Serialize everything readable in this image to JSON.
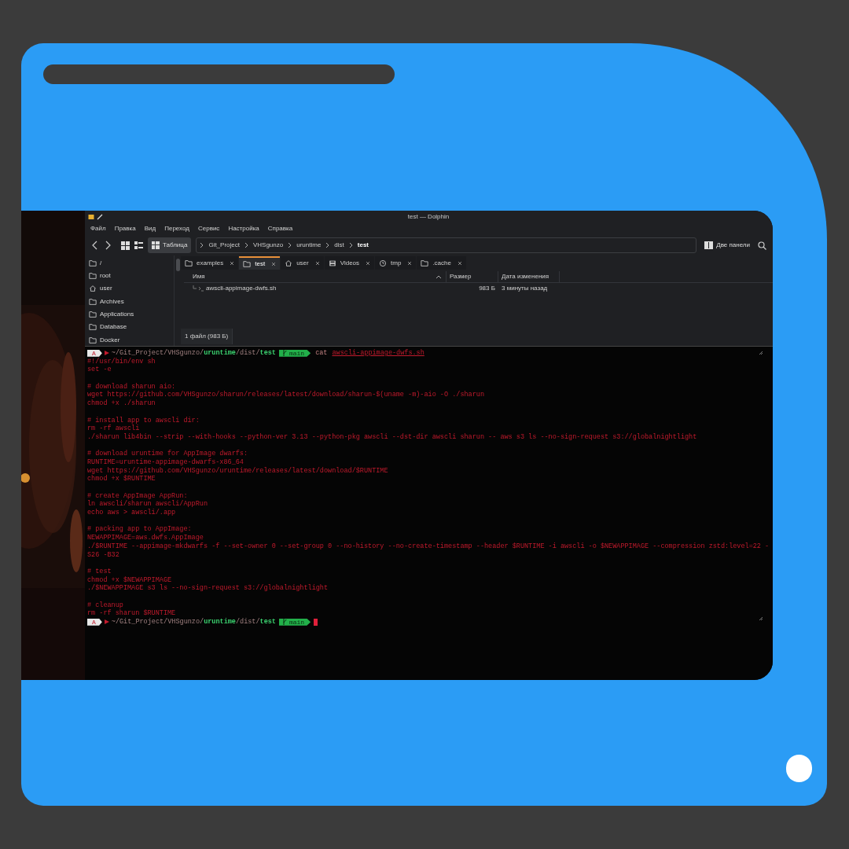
{
  "dolphin": {
    "title": "test — Dolphin",
    "menu": [
      "Файл",
      "Правка",
      "Вид",
      "Переход",
      "Сервис",
      "Настройка",
      "Справка"
    ],
    "view_button": "Таблица",
    "breadcrumb": [
      {
        "label": "Git_Project",
        "selected": false
      },
      {
        "label": "VHSgunzo",
        "selected": false
      },
      {
        "label": "uruntime",
        "selected": false
      },
      {
        "label": "dist",
        "selected": false
      },
      {
        "label": "test",
        "selected": true
      }
    ],
    "split_button": "Две панели",
    "places": [
      {
        "label": "/",
        "kind": "folder"
      },
      {
        "label": "root",
        "kind": "folder"
      },
      {
        "label": "user",
        "kind": "home"
      },
      {
        "label": "Archives",
        "kind": "folder"
      },
      {
        "label": "Applications",
        "kind": "folder"
      },
      {
        "label": "Database",
        "kind": "folder"
      },
      {
        "label": "Docker",
        "kind": "folder"
      }
    ],
    "tabs": [
      {
        "label": "examples",
        "kind": "folder",
        "selected": false
      },
      {
        "label": "test",
        "kind": "folder",
        "selected": true
      },
      {
        "label": "user",
        "kind": "home",
        "selected": false
      },
      {
        "label": "Videos",
        "kind": "film",
        "selected": false
      },
      {
        "label": "tmp",
        "kind": "clock",
        "selected": false
      },
      {
        "label": ".cache",
        "kind": "folder",
        "selected": false
      }
    ],
    "columns": [
      "Имя",
      "Размер",
      "Дата изменения"
    ],
    "rows": [
      {
        "name": "awscli-appimage-dwfs.sh",
        "size": "983 Б",
        "modified": "3 минуты назад"
      }
    ],
    "status": "1 файл (983 Б)"
  },
  "terminal": {
    "lines": [
      {
        "kind": "prompt",
        "badge": "A",
        "path": [
          {
            "text": "~/Git_Project/VHSgunzo/",
            "highlight": false
          },
          {
            "text": "uruntime",
            "highlight": true
          },
          {
            "text": "/dist/",
            "highlight": false
          },
          {
            "text": "test",
            "highlight": true
          }
        ],
        "branch": "main",
        "command": "cat",
        "argument": "awscli-appimage-dwfs.sh",
        "cursor": false
      },
      {
        "kind": "text",
        "text": "#!/usr/bin/env sh"
      },
      {
        "kind": "text",
        "text": "set -e"
      },
      {
        "kind": "blank"
      },
      {
        "kind": "text",
        "text": "# download sharun aio:"
      },
      {
        "kind": "text",
        "text": "wget https://github.com/VHSgunzo/sharun/releases/latest/download/sharun-$(uname -m)-aio -O ./sharun"
      },
      {
        "kind": "text",
        "text": "chmod +x ./sharun"
      },
      {
        "kind": "blank"
      },
      {
        "kind": "text",
        "text": "# install app to awscli dir:"
      },
      {
        "kind": "text",
        "text": "rm -rf awscli"
      },
      {
        "kind": "text",
        "text": "./sharun lib4bin --strip --with-hooks --python-ver 3.13 --python-pkg awscli --dst-dir awscli sharun -- aws s3 ls --no-sign-request s3://globalnightlight"
      },
      {
        "kind": "blank"
      },
      {
        "kind": "text",
        "text": "# download uruntime for AppImage dwarfs:"
      },
      {
        "kind": "text",
        "text": "RUNTIME=uruntime-appimage-dwarfs-x86_64"
      },
      {
        "kind": "text",
        "text": "wget https://github.com/VHSgunzo/uruntime/releases/latest/download/$RUNTIME"
      },
      {
        "kind": "text",
        "text": "chmod +x $RUNTIME"
      },
      {
        "kind": "blank"
      },
      {
        "kind": "text",
        "text": "# create AppImage AppRun:"
      },
      {
        "kind": "text",
        "text": "ln awscli/sharun awscli/AppRun"
      },
      {
        "kind": "text",
        "text": "echo aws > awscli/.app"
      },
      {
        "kind": "blank"
      },
      {
        "kind": "text",
        "text": "# packing app to AppImage:"
      },
      {
        "kind": "text",
        "text": "NEWAPPIMAGE=aws.dwfs.AppImage"
      },
      {
        "kind": "text",
        "text": "./$RUNTIME --appimage-mkdwarfs -f --set-owner 0 --set-group 0 --no-history --no-create-timestamp --header $RUNTIME -i awscli -o $NEWAPPIMAGE --compression zstd:level=22 -"
      },
      {
        "kind": "text",
        "text": "S26 -B32"
      },
      {
        "kind": "blank"
      },
      {
        "kind": "text",
        "text": "# test"
      },
      {
        "kind": "text",
        "text": "chmod +x $NEWAPPIMAGE"
      },
      {
        "kind": "text",
        "text": "./$NEWAPPIMAGE s3 ls --no-sign-request s3://globalnightlight"
      },
      {
        "kind": "blank"
      },
      {
        "kind": "text",
        "text": "# cleanup"
      },
      {
        "kind": "text",
        "text": "rm -rf sharun $RUNTIME"
      },
      {
        "kind": "prompt",
        "badge": "A",
        "path": [
          {
            "text": "~/Git_Project/VHSgunzo/",
            "highlight": false
          },
          {
            "text": "uruntime",
            "highlight": true
          },
          {
            "text": "/dist/",
            "highlight": false
          },
          {
            "text": "test",
            "highlight": true
          }
        ],
        "branch": "main",
        "cursor": true
      }
    ]
  }
}
